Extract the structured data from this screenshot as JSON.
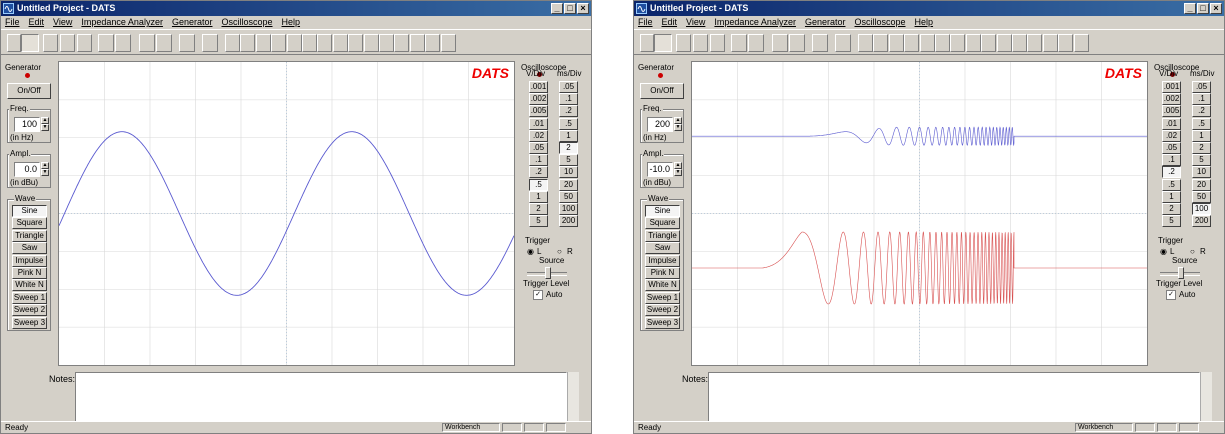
{
  "windows": [
    {
      "title": "Untitled Project - DATS",
      "menu": [
        "File",
        "Edit",
        "View",
        "Impedance Analyzer",
        "Generator",
        "Oscilloscope",
        "Help"
      ],
      "generator": {
        "label": "Generator",
        "onoff": "On/Off",
        "freq_label": "Freq.",
        "freq": "100",
        "freq_unit": "(in Hz)",
        "ampl_label": "Ampl.",
        "ampl": "0.0",
        "ampl_unit": "(in dBu)",
        "wave_label": "Wave"
      },
      "waves": [
        "Sine",
        "Square",
        "Triangle",
        "Saw",
        "Impulse",
        "Pink N",
        "White N",
        "Sweep 1",
        "Sweep 2",
        "Sweep 3"
      ],
      "selected_wave": "Sine",
      "scope": {
        "label": "Oscilloscope",
        "vdiv_header": "V/Div",
        "msdiv_header": "ms/Div"
      },
      "vdiv": [
        ".001",
        ".002",
        ".005",
        ".01",
        ".02",
        ".05",
        ".1",
        ".2",
        ".5",
        "1",
        "2",
        "5"
      ],
      "msdiv": [
        ".05",
        ".1",
        ".2",
        ".5",
        "1",
        "2",
        "5",
        "10",
        "20",
        "50",
        "100",
        "200"
      ],
      "selected_vdiv": ".5",
      "selected_msdiv": "2",
      "trigger": {
        "label": "Trigger",
        "left": "L",
        "right": "R",
        "source": "Source",
        "level": "Trigger Level",
        "auto": "Auto"
      },
      "logo": "DATS",
      "notes_label": "Notes:",
      "status": {
        "left": "Ready",
        "mode": "Workbench"
      },
      "colors": {
        "trace": "#5a5ad0"
      }
    },
    {
      "title": "Untitled Project - DATS",
      "menu": [
        "File",
        "Edit",
        "View",
        "Impedance Analyzer",
        "Generator",
        "Oscilloscope",
        "Help"
      ],
      "generator": {
        "label": "Generator",
        "onoff": "On/Off",
        "freq_label": "Freq.",
        "freq": "200",
        "freq_unit": "(in Hz)",
        "ampl_label": "Ampl.",
        "ampl": "-10.0",
        "ampl_unit": "(in dBu)",
        "wave_label": "Wave"
      },
      "waves": [
        "Sine",
        "Square",
        "Triangle",
        "Saw",
        "Impulse",
        "Pink N",
        "White N",
        "Sweep 1",
        "Sweep 2",
        "Sweep 3"
      ],
      "selected_wave": "Sine",
      "scope": {
        "label": "Oscilloscope",
        "vdiv_header": "V/Div",
        "msdiv_header": "ms/Div"
      },
      "vdiv": [
        ".001",
        ".002",
        ".005",
        ".01",
        ".02",
        ".05",
        ".1",
        ".2",
        ".5",
        "1",
        "2",
        "5"
      ],
      "msdiv": [
        ".05",
        ".1",
        ".2",
        ".5",
        "1",
        "2",
        "5",
        "10",
        "20",
        "50",
        "100",
        "200"
      ],
      "selected_vdiv": ".2",
      "selected_msdiv": "100",
      "trigger": {
        "label": "Trigger",
        "left": "L",
        "right": "R",
        "source": "Source",
        "level": "Trigger Level",
        "auto": "Auto"
      },
      "logo": "DATS",
      "notes_label": "Notes:",
      "status": {
        "left": "Ready",
        "mode": "Workbench"
      },
      "colors": {
        "trace1": "#5a5ad0",
        "trace2": "#d85050"
      }
    }
  ]
}
